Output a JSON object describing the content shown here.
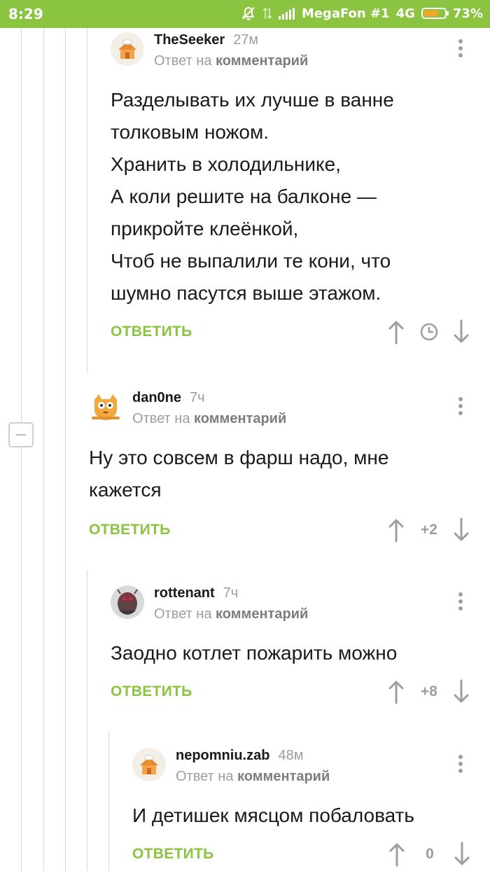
{
  "status_bar": {
    "time": "8:29",
    "carrier": "MegaFon #1",
    "network": "4G",
    "battery": "73%",
    "battery_level": 0.73
  },
  "reply_prefix": "Ответ на",
  "reply_link": "комментарий",
  "answer_label": "ОТВЕТИТЬ",
  "comments": [
    {
      "author": "TheSeeker",
      "age": "27м",
      "avatar": "house-avatar",
      "lines": [
        "Разделывать их лучше в ванне",
        "толковым ножом.",
        "Хранить в холодильнике,",
        "А коли решите на балконе —",
        "прикройте клеёнкой,",
        "Чтоб не выпалили те кони, что",
        "шумно пасутся выше этажом."
      ],
      "score": ""
    },
    {
      "author": "dan0ne",
      "age": "7ч",
      "avatar": "cat-avatar",
      "lines": [
        "Ну это совсем в фарш надо, мне",
        "кажется"
      ],
      "score": "+2"
    },
    {
      "author": "rottenant",
      "age": "7ч",
      "avatar": "photo-avatar",
      "lines": [
        "Заодно котлет пожарить можно"
      ],
      "score": "+8"
    },
    {
      "author": "nepomniu.zab",
      "age": "48м",
      "avatar": "house-avatar",
      "lines": [
        "И детишек мясцом побаловать"
      ],
      "score": "0"
    }
  ],
  "colors": {
    "accent": "#8ac440",
    "muted": "#9e9e9e",
    "text": "#1a1a1a",
    "rail": "#d6d6d6"
  }
}
